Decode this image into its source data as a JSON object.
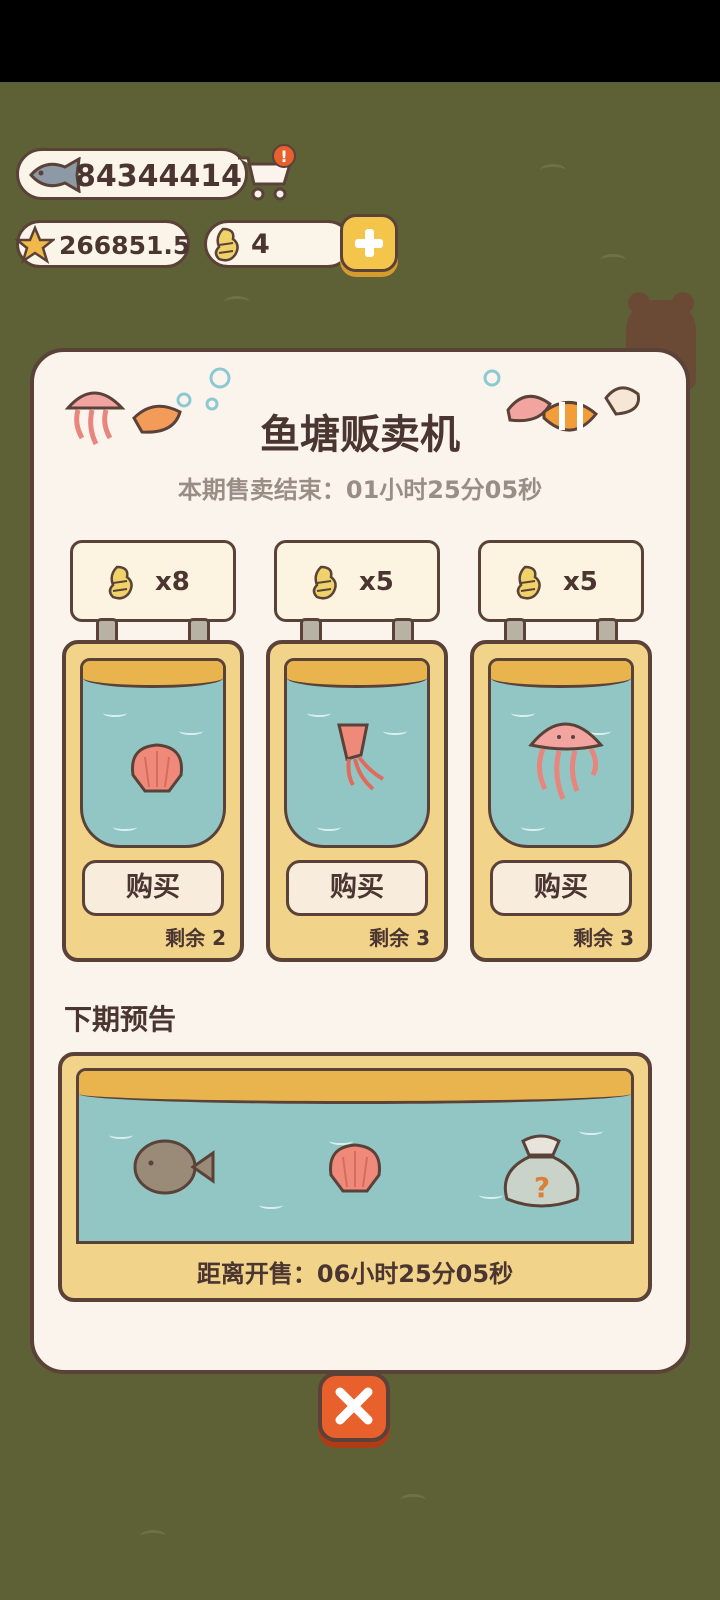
{
  "currency": {
    "fish_coins": "84344414",
    "stars": "266851.5",
    "seeds": "4"
  },
  "vending": {
    "title": "鱼塘贩卖机",
    "timer_label": "本期售卖结束：01小时25分05秒",
    "buy_label": "购买",
    "items": [
      {
        "name": "shell",
        "price": "x8",
        "remaining": "剩余 2"
      },
      {
        "name": "squid",
        "price": "x5",
        "remaining": "剩余 3"
      },
      {
        "name": "jellyfish",
        "price": "x5",
        "remaining": "剩余 3"
      }
    ]
  },
  "preview": {
    "title": "下期预告",
    "countdown": "距离开售：06小时25分05秒",
    "items": [
      "pufferfish",
      "shell",
      "mystery-bag"
    ]
  },
  "icons": {
    "fish": "fish-icon",
    "star": "star-icon",
    "seed": "seed-icon",
    "cart": "cart-icon",
    "add": "plus-icon",
    "close": "close-icon"
  },
  "colors": {
    "background": "#5e6136",
    "panel": "#fbf4ec",
    "outline": "#5a4238",
    "water": "#92c6c4",
    "tank": "#f2d38a",
    "accent_yellow": "#f3c54b",
    "close_orange": "#e8602c"
  }
}
